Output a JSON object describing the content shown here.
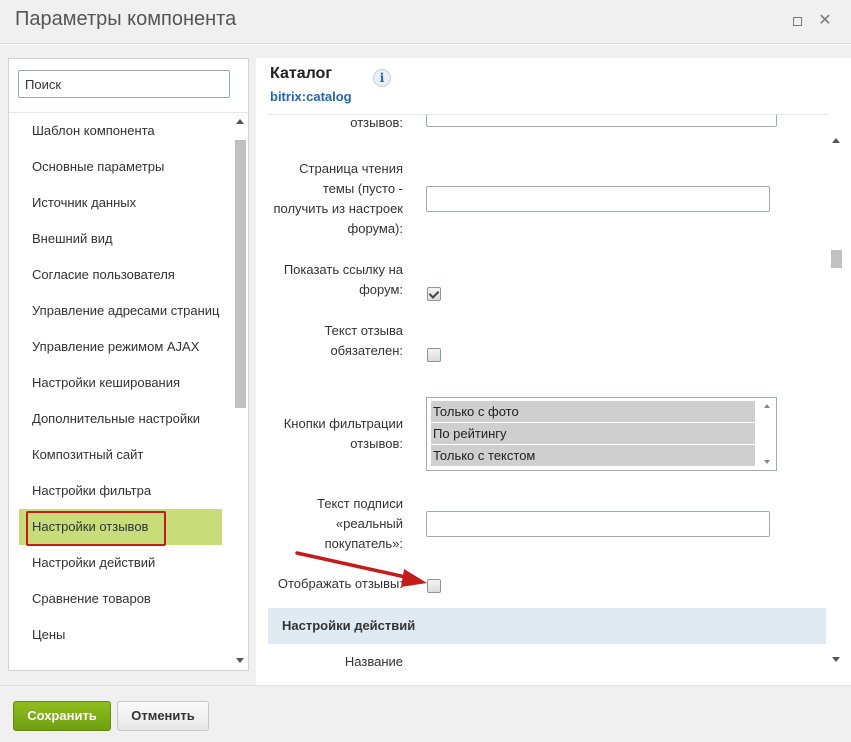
{
  "window": {
    "title": "Параметры компонента",
    "maximize_icon": "maximize-icon",
    "close_icon": "close-icon",
    "close_glyph": "✕"
  },
  "sidebar": {
    "search_placeholder": "Поиск",
    "items": [
      {
        "label": "Шаблон компонента"
      },
      {
        "label": "Основные параметры"
      },
      {
        "label": "Источник данных"
      },
      {
        "label": "Внешний вид"
      },
      {
        "label": "Согласие пользователя"
      },
      {
        "label": "Управление адресами страниц"
      },
      {
        "label": "Управление режимом AJAX"
      },
      {
        "label": "Настройки кеширования"
      },
      {
        "label": "Дополнительные настройки"
      },
      {
        "label": "Композитный сайт"
      },
      {
        "label": "Настройки фильтра"
      },
      {
        "label": "Настройки отзывов",
        "active": true
      },
      {
        "label": "Настройки действий"
      },
      {
        "label": "Сравнение товаров"
      },
      {
        "label": "Цены"
      }
    ]
  },
  "component": {
    "title": "Каталог",
    "code": "bitrix:catalog",
    "info_glyph": "i"
  },
  "form": {
    "fields": [
      {
        "label": "отзывов:",
        "type": "text",
        "value": ""
      },
      {
        "label": "Страница чтения темы (пусто - получить из настроек форума):",
        "type": "text",
        "value": ""
      },
      {
        "label": "Показать ссылку на форум:",
        "type": "checkbox",
        "checked": true
      },
      {
        "label": "Текст отзыва обязателен:",
        "type": "checkbox",
        "checked": false
      },
      {
        "label": "Кнопки фильтрации отзывов:",
        "type": "multiselect",
        "options": [
          "Только с фото",
          "По рейтингу",
          "Только с текстом"
        ]
      },
      {
        "label": "Текст подписи «реальный покупатель»:",
        "type": "text",
        "value": ""
      },
      {
        "label": "Отображать отзывы:",
        "type": "checkbox",
        "checked": false
      }
    ],
    "section_title": "Настройки действий",
    "next_field_label": "Название"
  },
  "footer": {
    "save_label": "Сохранить",
    "cancel_label": "Отменить"
  },
  "colors": {
    "accent_green": "#7aab16",
    "active_item_bg": "#c8dc7a",
    "highlight_red": "#c41b1b",
    "section_bg": "#dfeaf3",
    "link_blue": "#2067b0"
  }
}
